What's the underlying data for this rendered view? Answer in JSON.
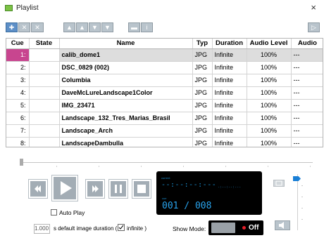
{
  "window": {
    "title": "Playlist",
    "close_glyph": "×"
  },
  "toolbar": {
    "buttons": [
      {
        "icon": "add-icon"
      },
      {
        "icon": "remove-icon"
      },
      {
        "icon": "remove-all-icon"
      },
      {
        "icon": "move-top-icon"
      },
      {
        "icon": "move-up-icon"
      },
      {
        "icon": "move-down-icon"
      },
      {
        "icon": "move-bottom-icon"
      },
      {
        "icon": "edit-icon"
      },
      {
        "icon": "info-icon"
      },
      {
        "icon": "panel-toggle-icon"
      }
    ]
  },
  "table": {
    "columns": [
      "Cue",
      "State",
      "Name",
      "Typ",
      "Duration",
      "Audio Level",
      "Audio"
    ],
    "rows": [
      {
        "cue": "1:",
        "state": "",
        "name": "calib_dome1",
        "type": "JPG",
        "duration": "Infinite",
        "audio_level": "100%",
        "audio": "---",
        "selected": true
      },
      {
        "cue": "2:",
        "state": "",
        "name": "DSC_0829 (002)",
        "type": "JPG",
        "duration": "Infinite",
        "audio_level": "100%",
        "audio": "---",
        "selected": false
      },
      {
        "cue": "3:",
        "state": "",
        "name": "Columbia",
        "type": "JPG",
        "duration": "Infinite",
        "audio_level": "100%",
        "audio": "---",
        "selected": false
      },
      {
        "cue": "4:",
        "state": "",
        "name": "DaveMcLureLandscape1Color",
        "type": "JPG",
        "duration": "Infinite",
        "audio_level": "100%",
        "audio": "---",
        "selected": false
      },
      {
        "cue": "5:",
        "state": "",
        "name": "IMG_23471",
        "type": "JPG",
        "duration": "Infinite",
        "audio_level": "100%",
        "audio": "---",
        "selected": false
      },
      {
        "cue": "6:",
        "state": "",
        "name": "Landscape_132_Tres_Marias_Brasil",
        "type": "JPG",
        "duration": "Infinite",
        "audio_level": "100%",
        "audio": "---",
        "selected": false
      },
      {
        "cue": "7:",
        "state": "",
        "name": "Landscape_Arch",
        "type": "JPG",
        "duration": "Infinite",
        "audio_level": "100%",
        "audio": "---",
        "selected": false
      },
      {
        "cue": "8:",
        "state": "",
        "name": "LandscapeDambulla",
        "type": "JPG",
        "duration": "Infinite",
        "audio_level": "100%",
        "audio": "---",
        "selected": false
      }
    ]
  },
  "transport": {
    "buttons": [
      "rewind-icon",
      "play-icon",
      "fast-forward-icon",
      "pause-icon",
      "stop-icon"
    ],
    "auto_play_label": "Auto Play",
    "auto_play_checked": false
  },
  "display": {
    "time_caption": "current",
    "time": "--:--:--:---",
    "remaining": "-:--:--:---",
    "cue_caption": "cue",
    "counter": "001 / 008"
  },
  "settings": {
    "default_duration": "1.000",
    "default_duration_label": "s default image duration (",
    "infinite_checked": true,
    "infinite_label": "infinite )",
    "show_mode_label": "Show Mode:",
    "show_mode_state": "Off"
  },
  "colors": {
    "selected_cue": "#c8458f",
    "display_text": "#29a4ee",
    "toggle_dot": "#e8202a",
    "volume_thumb": "#1a7fd6"
  }
}
